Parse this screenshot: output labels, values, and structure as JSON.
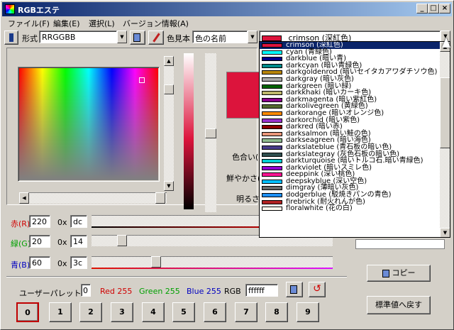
{
  "title": "RGBエステ",
  "menu": [
    "ファイル(F)",
    "編集(E)",
    "選択(L)",
    "バージョン情報(A)"
  ],
  "toolbar": {
    "format_label": "形式",
    "format_value": "RRGGBB",
    "sample_label": "色見本",
    "sample_value": "色の名前",
    "color_value": "crimson (深紅色)"
  },
  "color_sample_hex": "#dc143c",
  "hsl_labels": {
    "hue": "色合い(H)",
    "sat": "鮮やかさ(S)",
    "lum": "明るさ(L)"
  },
  "rgb": {
    "red": {
      "label": "赤(R)",
      "dec": "220",
      "prefix": "0x",
      "hex": "dc"
    },
    "green": {
      "label": "緑(G)",
      "dec": "20",
      "prefix": "0x",
      "hex": "14"
    },
    "blue": {
      "label": "青(B)",
      "dec": "60",
      "prefix": "0x",
      "hex": "3c"
    }
  },
  "palette": {
    "label": "ユーザーパレット:",
    "index": "0",
    "red": "Red 255",
    "green": "Green 255",
    "blue": "Blue 255",
    "rgb_label": "RGB",
    "rgb_value": "ffffff",
    "buttons": [
      "0",
      "1",
      "2",
      "3",
      "4",
      "5",
      "6",
      "7",
      "8",
      "9"
    ]
  },
  "buttons": {
    "copy": "コピー",
    "reset": "標準値へ戻す"
  },
  "dropdown_items": [
    {
      "name": "crimson (深紅色)",
      "color": "#dc143c",
      "selected": true
    },
    {
      "name": "cyan (青緑色)",
      "color": "#00ffff"
    },
    {
      "name": "darkblue (暗い青)",
      "color": "#00008b"
    },
    {
      "name": "darkcyan (暗い青緑色)",
      "color": "#008b8b"
    },
    {
      "name": "darkgoldenrod (暗いセイタカアワダチソウ色)",
      "color": "#b8860b"
    },
    {
      "name": "darkgray (暗い灰色)",
      "color": "#a9a9a9"
    },
    {
      "name": "darkgreen (暗い緑)",
      "color": "#006400"
    },
    {
      "name": "darkkhaki (暗いカーキ色)",
      "color": "#bdb76b"
    },
    {
      "name": "darkmagenta (暗い紫紅色)",
      "color": "#8b008b"
    },
    {
      "name": "darkolivegreen (黄緑色)",
      "color": "#556b2f"
    },
    {
      "name": "darkorange (暗いオレンジ色)",
      "color": "#ff8c00"
    },
    {
      "name": "darkorchid (暗い紫色)",
      "color": "#9932cc"
    },
    {
      "name": "darkred (暗い赤)",
      "color": "#8b0000"
    },
    {
      "name": "darksalmon (暗い鮭の色)",
      "color": "#e9967a"
    },
    {
      "name": "darkseagreen (暗い海色)",
      "color": "#8fbc8f"
    },
    {
      "name": "darkslateblue (青石板の暗い色)",
      "color": "#483d8b"
    },
    {
      "name": "darkslategray (灰色石板の暗い色)",
      "color": "#2f4f4f"
    },
    {
      "name": "darkturquoise (暗いトルコ石.暗い青緑色)",
      "color": "#00ced1"
    },
    {
      "name": "darkviolet (暗いスミレ色)",
      "color": "#9400d3"
    },
    {
      "name": "deeppink (深い桃色)",
      "color": "#ff1493"
    },
    {
      "name": "deepskyblue (深い空色)",
      "color": "#00bfff"
    },
    {
      "name": "dimgray (薄暗い灰色)",
      "color": "#696969"
    },
    {
      "name": "dodgerblue (駁焼きパンの青色)",
      "color": "#1e90ff"
    },
    {
      "name": "firebrick (耐火れんが色)",
      "color": "#b22222"
    },
    {
      "name": "floralwhite (花の白)",
      "color": "#fffaf0"
    }
  ]
}
